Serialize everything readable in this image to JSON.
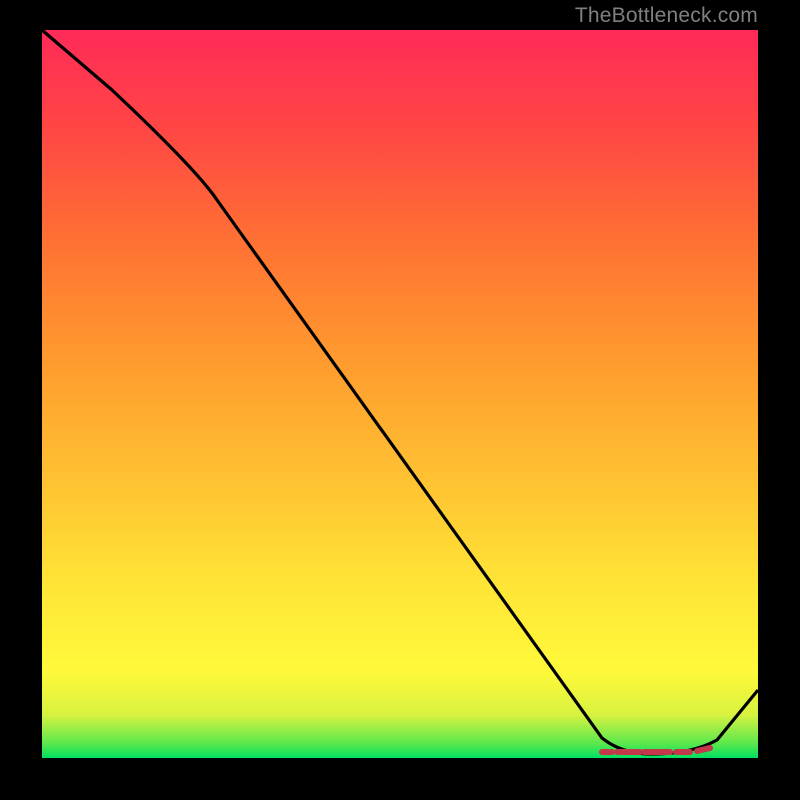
{
  "watermark": "TheBottleneck.com",
  "chart_data": {
    "type": "line",
    "title": "",
    "xlabel": "",
    "ylabel": "",
    "xlim": [
      0,
      100
    ],
    "ylim": [
      0,
      100
    ],
    "series": [
      {
        "name": "curve",
        "x": [
          0,
          10,
          22,
          50,
          78,
          84,
          90,
          95,
          100
        ],
        "values": [
          100,
          92,
          80,
          41,
          3,
          1,
          1,
          3,
          10
        ]
      }
    ],
    "optimal_band": {
      "x_start": 78,
      "x_end": 92
    },
    "note": "x/y are percent of plot width/height; curve descends from top-left, flattens near bottom-right then rises slightly"
  }
}
